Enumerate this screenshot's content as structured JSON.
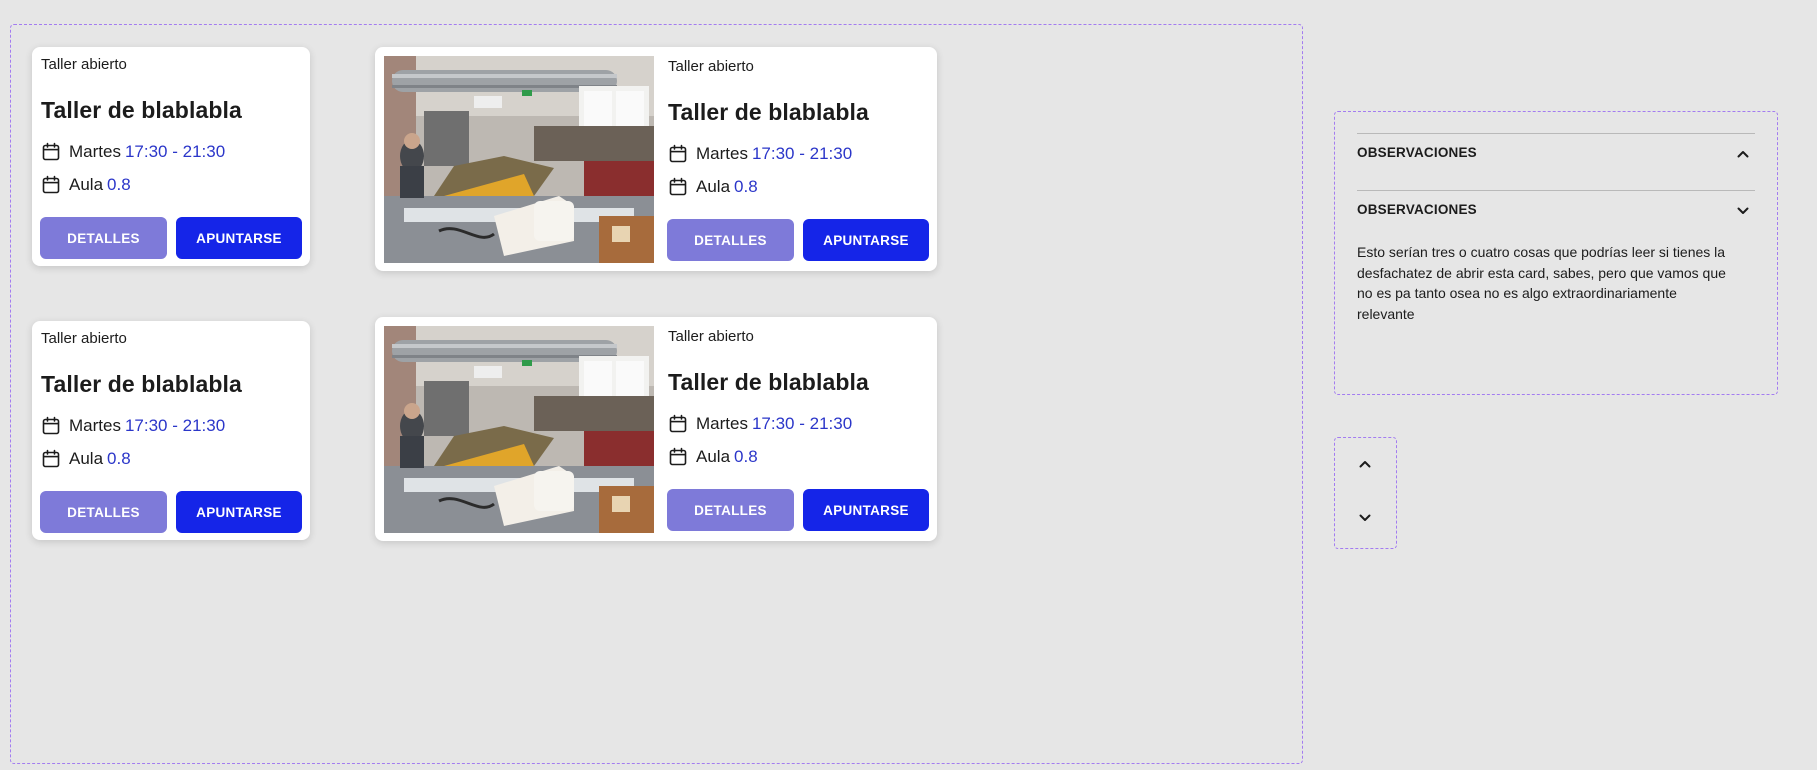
{
  "cards": [
    {
      "eyebrow": "Taller abierto",
      "title": "Taller de blablabla",
      "day_label": "Martes",
      "time_value": "17:30 - 21:30",
      "room_label": "Aula",
      "room_value": "0.8",
      "details_label": "DETALLES",
      "signup_label": "APUNTARSE",
      "has_image": false
    },
    {
      "eyebrow": "Taller abierto",
      "title": "Taller de blablabla",
      "day_label": "Martes",
      "time_value": "17:30 - 21:30",
      "room_label": "Aula",
      "room_value": "0.8",
      "details_label": "DETALLES",
      "signup_label": "APUNTARSE",
      "has_image": true
    },
    {
      "eyebrow": "Taller abierto",
      "title": "Taller de blablabla",
      "day_label": "Martes",
      "time_value": "17:30 - 21:30",
      "room_label": "Aula",
      "room_value": "0.8",
      "details_label": "DETALLES",
      "signup_label": "APUNTARSE",
      "has_image": false
    },
    {
      "eyebrow": "Taller abierto",
      "title": "Taller de blablabla",
      "day_label": "Martes",
      "time_value": "17:30 - 21:30",
      "room_label": "Aula",
      "room_value": "0.8",
      "details_label": "DETALLES",
      "signup_label": "APUNTARSE",
      "has_image": true
    }
  ],
  "accordion": {
    "items": [
      {
        "label": "OBSERVACIONES",
        "expanded": false,
        "icon": "chevron-up-icon"
      },
      {
        "label": "OBSERVACIONES",
        "expanded": true,
        "icon": "chevron-down-icon",
        "body": "Esto serían tres o cuatro cosas que podrías leer si tienes la desfachatez de abrir esta card, sabes, pero que vamos que no es pa tanto osea no es algo extraordinariamente relevante"
      }
    ]
  },
  "scroller": {
    "up_icon": "chevron-up-icon",
    "down_icon": "chevron-down-icon"
  },
  "colors": {
    "background": "#e6e6e6",
    "frame_dash": "#a37cf0",
    "primary_button": "#1525e8",
    "secondary_button": "#7e7ad9",
    "accent_text": "#2b36c9"
  }
}
